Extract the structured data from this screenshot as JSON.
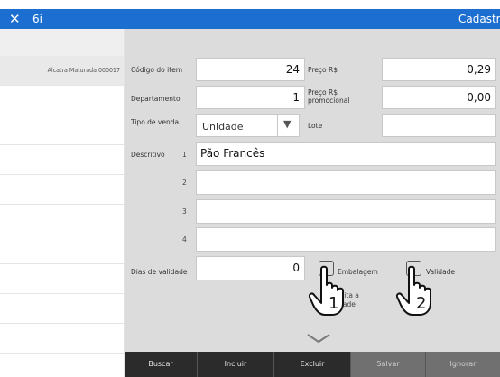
{
  "window": {
    "close_glyph": "✕",
    "app_number": "6i",
    "title": "Cadastr"
  },
  "sidebar": {
    "items": [
      {
        "label": ""
      },
      {
        "label": "Alcatra Maturada  000017"
      },
      {
        "label": ""
      },
      {
        "label": ""
      },
      {
        "label": ""
      },
      {
        "label": ""
      },
      {
        "label": ""
      },
      {
        "label": ""
      },
      {
        "label": ""
      },
      {
        "label": ""
      },
      {
        "label": ""
      }
    ]
  },
  "form": {
    "codigo_label": "Código do item",
    "codigo_value": "24",
    "departamento_label": "Departamento",
    "departamento_value": "1",
    "tipo_venda_label": "Tipo de venda",
    "tipo_venda_value": "Unidade",
    "preco_label": "Preço R$",
    "preco_value": "0,29",
    "preco_promo_label_1": "Preço R$",
    "preco_promo_label_2": "promocional",
    "preco_promo_value": "0,00",
    "lote_label": "Lote",
    "lote_value": "",
    "descritivo_label": "Descritivo",
    "descritivo_lines": [
      {
        "num": "1",
        "value": "Pão Francês"
      },
      {
        "num": "2",
        "value": ""
      },
      {
        "num": "3",
        "value": ""
      },
      {
        "num": "4",
        "value": ""
      }
    ],
    "dias_validade_label": "Dias de validade",
    "dias_validade_value": "0",
    "embalagem_label": "Embalagem",
    "validade_label": "Validade",
    "hint_line1": "licita a",
    "hint_line2": "idade",
    "hand1_number": "1",
    "hand2_number": "2"
  },
  "toolbar": {
    "buscar": "Buscar",
    "incluir": "Incluir",
    "excluir": "Excluir",
    "salvar": "Salvar",
    "ignorar": "Ignorar"
  },
  "icons": {
    "close": "close-icon",
    "dropdown": "chevron-down-icon",
    "expand": "chevron-down-icon",
    "hand": "pointing-hand-icon"
  },
  "colors": {
    "titlebar": "#1c6fd0",
    "panel": "#dcdcdc",
    "toolbar": "#2b2b2b",
    "toolbar_disabled": "#707070"
  }
}
